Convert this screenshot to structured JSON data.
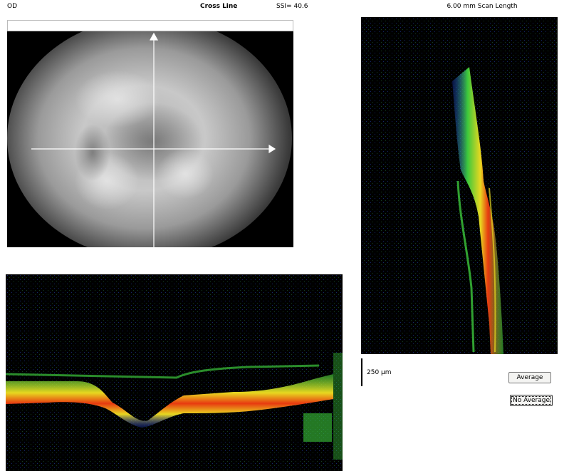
{
  "header": {
    "eye": "OD",
    "scan_type": "Cross Line",
    "ssi": "SSI= 40.6",
    "scan_length": "6.00 mm Scan Length"
  },
  "scale": {
    "label": "250 µm"
  },
  "buttons": {
    "average": "Average",
    "no_average": "No Average"
  },
  "colors": {
    "oct_background": "#000000",
    "oct_signal_low": "#1c3cd8",
    "oct_signal_mid": "#3cc83c",
    "oct_signal_high": "#e8d820",
    "oct_signal_peak": "#e83a10"
  }
}
